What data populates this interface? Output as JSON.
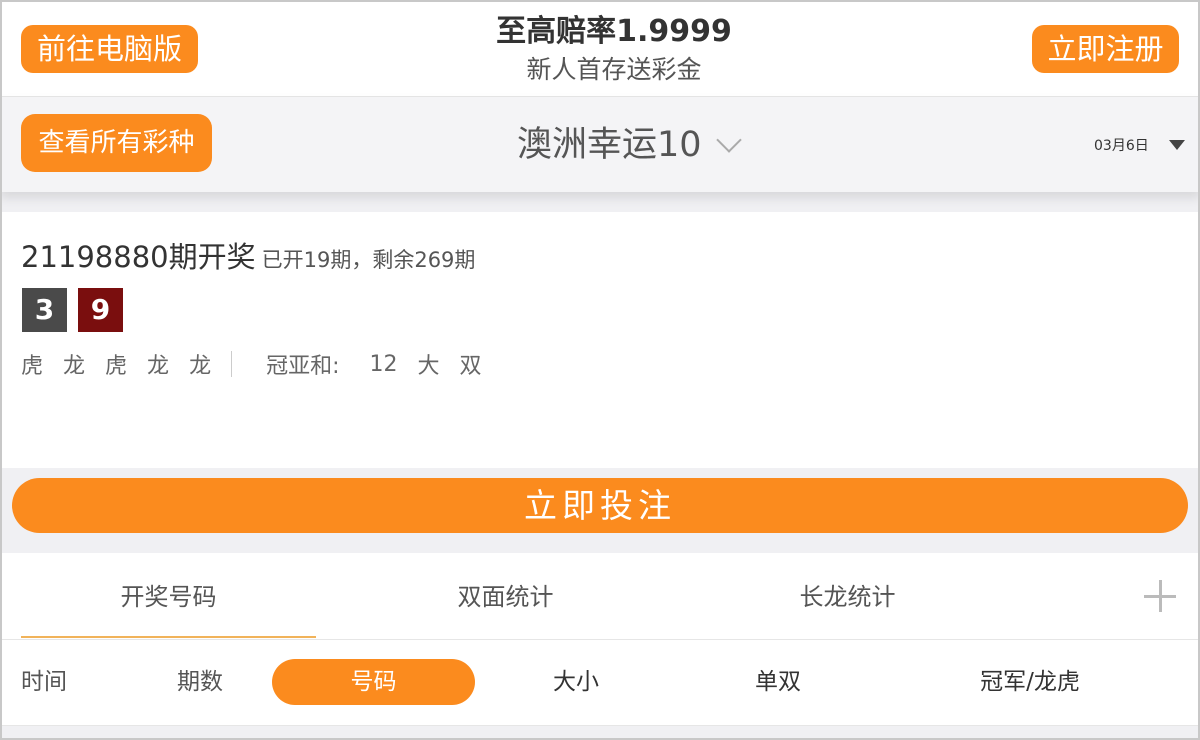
{
  "header": {
    "pc_button": "前往电脑版",
    "promo_title": "至高赔率1.9999",
    "promo_subtitle": "新人首存送彩金",
    "register_button": "立即注册"
  },
  "selector": {
    "all_lotteries_button": "查看所有彩种",
    "lottery_name": "澳洲幸运10",
    "date": "03月6日"
  },
  "result": {
    "issue": "21198880期开奖",
    "progress": "已开19期，剩余269期",
    "balls": [
      "3",
      "9"
    ],
    "dragon_tiger": [
      "虎",
      "龙",
      "虎",
      "龙",
      "龙"
    ],
    "sum_label": "冠亚和:",
    "sum_value": "12",
    "size": "大",
    "parity": "双"
  },
  "bet_button": "立即投注",
  "tabs": [
    {
      "label": "开奖号码",
      "active": true
    },
    {
      "label": "双面统计",
      "active": false
    },
    {
      "label": "长龙统计",
      "active": false
    }
  ],
  "columns": {
    "time": "时间",
    "issue": "期数",
    "number": "号码",
    "size": "大小",
    "parity": "单双",
    "champion": "冠军/龙虎"
  },
  "colors": {
    "accent": "#fb8b1e",
    "ball_3": "#4a4a4a",
    "ball_9": "#7a0e0e",
    "tab_underline": "#f1b35a"
  }
}
